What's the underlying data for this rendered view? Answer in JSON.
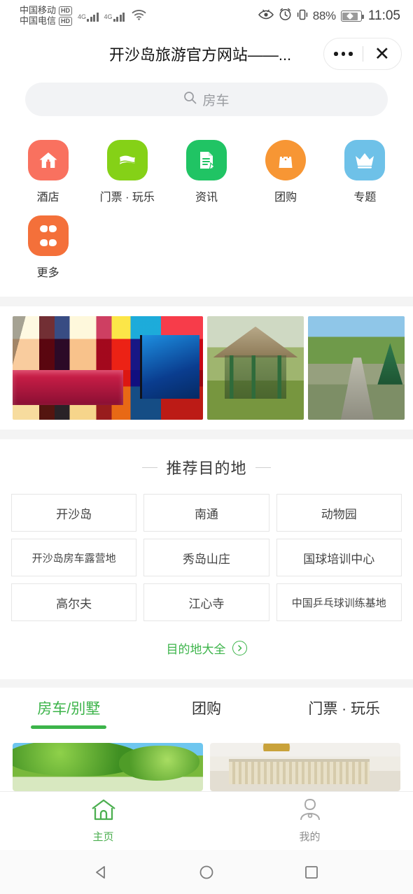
{
  "statusbar": {
    "carrier1": "中国移动",
    "carrier1_badge": "HD",
    "carrier2": "中国电信",
    "carrier2_badge": "HD",
    "network1": "4G",
    "network2": "4G",
    "battery_percent": "88%",
    "time": "11:05",
    "icons": [
      "eye-icon",
      "alarm-icon",
      "vibrate-icon",
      "battery-icon"
    ]
  },
  "titlebar": {
    "title": "开沙岛旅游官方网站——...",
    "menu_icon": "more-dots-icon",
    "close_icon": "close-icon"
  },
  "search": {
    "placeholder": "房车",
    "icon": "search-icon"
  },
  "quick_links": [
    {
      "label": "酒店",
      "icon": "hotel-home-icon",
      "color": "#f9715f",
      "shape": "squircle"
    },
    {
      "label": "门票 · 玩乐",
      "icon": "ticket-icon",
      "color": "#85d117",
      "shape": "squircle"
    },
    {
      "label": "资讯",
      "icon": "news-document-icon",
      "color": "#20c464",
      "shape": "squircle"
    },
    {
      "label": "团购",
      "icon": "shopping-bag-icon",
      "color": "#f79634",
      "shape": "round"
    },
    {
      "label": "专题",
      "icon": "crown-icon",
      "color": "#6ec1e8",
      "shape": "squircle"
    },
    {
      "label": "更多",
      "icon": "more-grid-icon",
      "color": "#f4703a",
      "shape": "squircle"
    }
  ],
  "photos": [
    {
      "name": "rv-interior-photo",
      "alt": "房车内部 红色沙发",
      "art": "art-rv"
    },
    {
      "name": "gazebo-photo",
      "alt": "茅草亭 草坪",
      "art": "art-gazebo"
    },
    {
      "name": "garden-path-photo",
      "alt": "园区小路 绿化",
      "art": "art-path"
    }
  ],
  "destinations": {
    "title": "推荐目的地",
    "items": [
      "开沙岛",
      "南通",
      "动物园",
      "开沙岛房车露营地",
      "秀岛山庄",
      "国球培训中心",
      "高尔夫",
      "江心寺",
      "中国乒乓球训练基地"
    ],
    "more_label": "目的地大全",
    "more_icon": "circle-arrow-right-icon",
    "accent": "#3cb44a"
  },
  "tabs": {
    "items": [
      {
        "label": "房车/别墅",
        "active": true
      },
      {
        "label": "团购",
        "active": false
      },
      {
        "label": "门票 · 玩乐",
        "active": false
      }
    ],
    "active_color": "#3cb44a"
  },
  "cards": [
    {
      "name": "card-trees",
      "art": "art-trees"
    },
    {
      "name": "card-hall",
      "art": "art-hall"
    }
  ],
  "bottomnav": {
    "items": [
      {
        "label": "主页",
        "icon": "home-icon",
        "active": true
      },
      {
        "label": "我的",
        "icon": "profile-icon",
        "active": false
      }
    ],
    "active_color": "#4caf50",
    "inactive_color": "#8e8e8e"
  },
  "androidnav": {
    "back_icon": "back-triangle-icon",
    "home_icon": "home-circle-icon",
    "recents_icon": "recents-square-icon"
  }
}
